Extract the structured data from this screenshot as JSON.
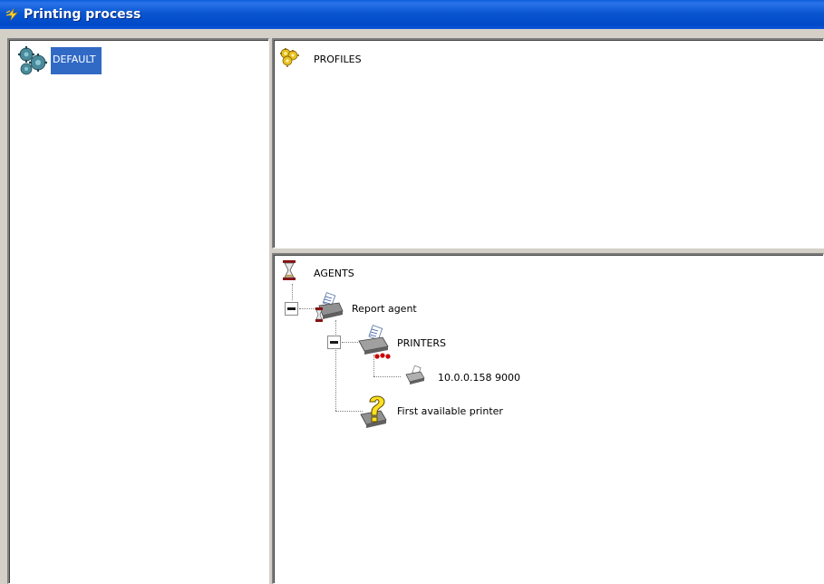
{
  "window": {
    "title": "Printing process"
  },
  "left_tree": {
    "items": [
      {
        "label": "DEFAULT",
        "icon": "gears-icon",
        "selected": true
      }
    ]
  },
  "profiles": {
    "label": "PROFILES",
    "icon": "gears-yellow-icon"
  },
  "agents": {
    "label": "AGENTS",
    "icon": "hourglass-icon",
    "children": [
      {
        "label": "Report agent",
        "icon": "report-agent-icon",
        "expanded": true,
        "children": [
          {
            "label": "PRINTERS",
            "icon": "printers-icon",
            "expanded": true,
            "children": [
              {
                "label": "10.0.0.158 9000",
                "icon": "printer-icon"
              }
            ]
          },
          {
            "label": "First available printer",
            "icon": "printer-question-icon"
          }
        ]
      }
    ]
  },
  "colors": {
    "titlebar": "#0054e3",
    "selection": "#316ac5",
    "background": "#d4d0c8"
  }
}
